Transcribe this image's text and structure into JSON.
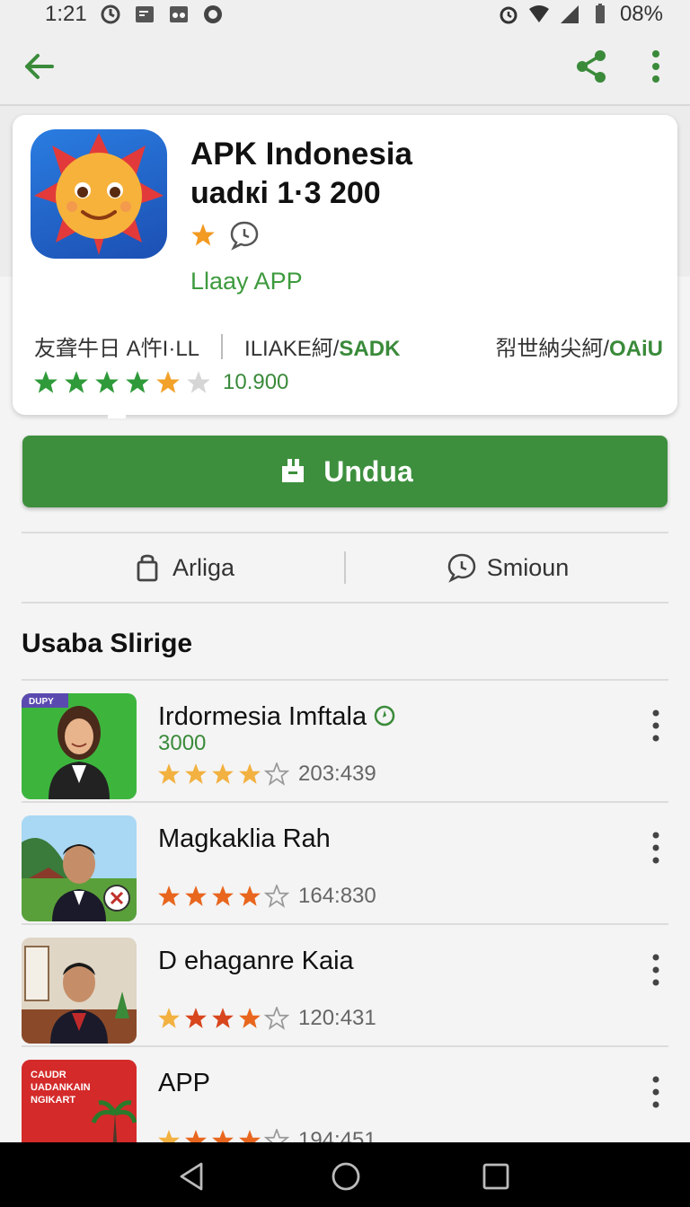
{
  "status": {
    "time": "1:21",
    "battery": "08%"
  },
  "app": {
    "title": "APK Indonesia",
    "version": "uadкi 1·3 200",
    "developer": "Llaay APP",
    "meta": {
      "item1": "友聋牛日 A忤I·LL",
      "item2_a": "ILIAKE䋍/",
      "item2_b": "SADK",
      "item3_a": "㡂世納尖䋍/",
      "item3_b": "OAiU"
    },
    "rating_count": "10.900"
  },
  "download_button": {
    "label": "Unduа"
  },
  "actions": {
    "left_label": "Arliga",
    "right_label": "Smioun"
  },
  "section": {
    "title": "Usaba Slirige"
  },
  "list": [
    {
      "title": "Irdormesia  Imftala",
      "sub": "3000",
      "count": "203:439",
      "badge": "DUPY"
    },
    {
      "title": "Magkaklia Rah",
      "sub": "",
      "count": "164:830"
    },
    {
      "title": "D ehaganre Kaia",
      "sub": "",
      "count": "120:431"
    },
    {
      "title": "APP",
      "sub": "",
      "count": "194:451",
      "thumb_text": "CAUDR\nUADANKAIN\nNGIKART"
    }
  ],
  "colors": {
    "accent": "#3d8f3d",
    "star_orange": "#f29a22",
    "star_green": "#2f9a3a"
  },
  "icons": [
    "back-arrow-icon",
    "share-icon",
    "more-vert-icon",
    "star-icon",
    "chat-icon",
    "download-icon",
    "bag-icon",
    "verified-icon"
  ]
}
